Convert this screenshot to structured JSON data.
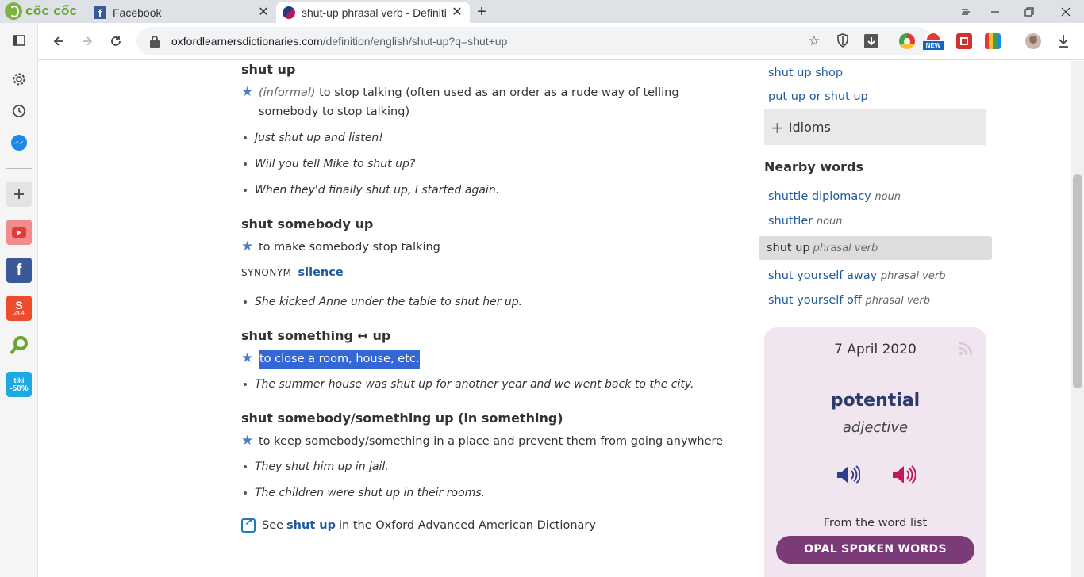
{
  "browser": {
    "brand": "cốc cốc",
    "tabs": [
      {
        "title": "Facebook",
        "favicon": "facebook-icon",
        "active": false
      },
      {
        "title": "shut-up phrasal verb - Definiti",
        "favicon": "oxford-icon",
        "active": true
      }
    ],
    "url_host": "oxfordlearnersdictionaries.com",
    "url_path": "/definition/english/shut-up?q=shut+up",
    "ext_badge": "NEW"
  },
  "sidebar": {
    "items": [
      "panel-icon",
      "settings-icon",
      "history-icon",
      "messenger-icon",
      "add-icon",
      "youtube-icon",
      "facebook-icon",
      "shopee-icon",
      "cococ-icon",
      "tiki-icon"
    ],
    "shopee_label": "24.4",
    "tiki_top": "tiki",
    "tiki_bottom": "-50%"
  },
  "entry": {
    "s1_head": "shut up",
    "s1_label": "(informal)",
    "s1_def": " to stop talking (often used as an order as a rude way of telling somebody to stop talking)",
    "s1_ex": [
      "Just shut up and listen!",
      "Will you tell Mike to shut up?",
      "When they'd finally shut up, I started again."
    ],
    "s2_head": "shut somebody up",
    "s2_def": "to make somebody stop talking",
    "s2_syn_label": "SYNONYM",
    "s2_syn_word": "silence",
    "s2_ex": [
      "She kicked Anne under the table to shut her up."
    ],
    "s3_head": "shut something ↔ up",
    "s3_def": "to close a room, house, etc.",
    "s3_ex": [
      "The summer house was shut up for another year and we went back to the city."
    ],
    "s4_head": "shut somebody/something up (in something)",
    "s4_def": "to keep somebody/something in a place and prevent them from going anywhere",
    "s4_ex": [
      "They shut him up in jail.",
      "The children were shut up in their rooms."
    ],
    "see_pre": "See",
    "see_link": "shut up",
    "see_post": "in the Oxford Advanced American Dictionary"
  },
  "right": {
    "links": [
      "shut up shop",
      "put up or shut up"
    ],
    "idioms": "Idioms",
    "nearby_title": "Nearby words",
    "nearby": [
      {
        "word": "shuttle diplomacy",
        "pos": "noun"
      },
      {
        "word": "shuttler",
        "pos": "noun"
      },
      {
        "word": "shut up",
        "pos": "phrasal verb",
        "current": true
      },
      {
        "word": "shut yourself away",
        "pos": "phrasal verb"
      },
      {
        "word": "shut yourself off",
        "pos": "phrasal verb"
      }
    ],
    "wotd": {
      "date": "7 April 2020",
      "word": "potential",
      "pos": "adjective",
      "from": "From the word list",
      "button": "OPAL SPOKEN WORDS"
    }
  },
  "colors": {
    "link": "#1f5a9c",
    "highlight": "#3367d6",
    "wotd_bg": "#f1e6f0",
    "wotd_button": "#7a3b78"
  }
}
